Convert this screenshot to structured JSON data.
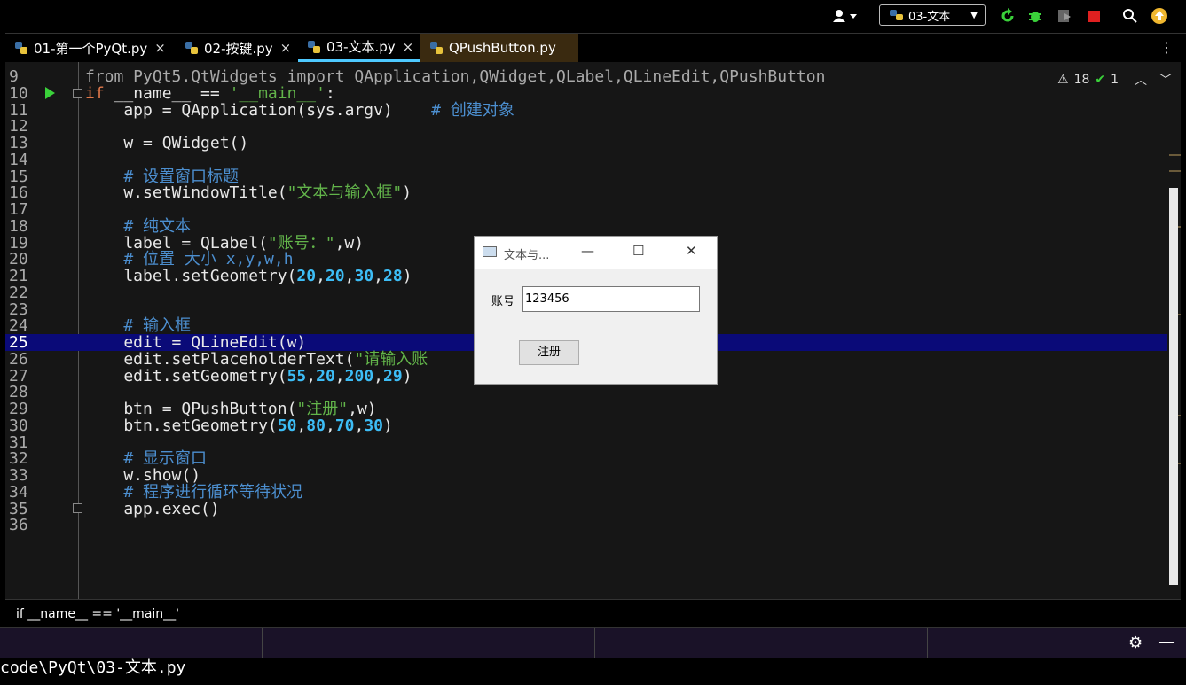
{
  "toolbar": {
    "run_config": "03-文本",
    "icons": [
      "user-icon",
      "run-icon",
      "debug-icon",
      "coverage-icon",
      "stop-icon",
      "search-icon",
      "update-icon"
    ]
  },
  "tabs": [
    {
      "label": "01-第一个PyQt.py"
    },
    {
      "label": "02-按键.py"
    },
    {
      "label": "03-文本.py"
    },
    {
      "label": "QPushButton.py"
    }
  ],
  "editor": {
    "top_fragment": "from PyQt5.QtWidgets import QApplication,QWidget,QLabel,QLineEdit,QPushButton",
    "inspections": {
      "warnings": "18",
      "ok": "1"
    },
    "lines": [
      {
        "n": "9",
        "segs": []
      },
      {
        "n": "10",
        "segs": [
          {
            "c": "kw",
            "t": "if "
          },
          {
            "c": "fn",
            "t": "__name__ == "
          },
          {
            "c": "str",
            "t": "'__main__'"
          },
          {
            "c": "fn",
            "t": ":"
          }
        ]
      },
      {
        "n": "11",
        "segs": [
          {
            "c": "fn",
            "t": "    app = QApplication(sys.argv)    "
          },
          {
            "c": "cmt",
            "t": "# 创建对象"
          }
        ]
      },
      {
        "n": "12",
        "segs": []
      },
      {
        "n": "13",
        "segs": [
          {
            "c": "fn",
            "t": "    w = QWidget()"
          }
        ]
      },
      {
        "n": "14",
        "segs": []
      },
      {
        "n": "15",
        "segs": [
          {
            "c": "cmt",
            "t": "    # 设置窗口标题"
          }
        ]
      },
      {
        "n": "16",
        "segs": [
          {
            "c": "fn",
            "t": "    w.setWindowTitle("
          },
          {
            "c": "str",
            "t": "\"文本与输入框\""
          },
          {
            "c": "fn",
            "t": ")"
          }
        ]
      },
      {
        "n": "17",
        "segs": []
      },
      {
        "n": "18",
        "segs": [
          {
            "c": "cmt",
            "t": "    # 纯文本"
          }
        ]
      },
      {
        "n": "19",
        "segs": [
          {
            "c": "fn",
            "t": "    label = QLabel("
          },
          {
            "c": "str",
            "t": "\"账号：\""
          },
          {
            "c": "fn",
            "t": ",w)"
          }
        ]
      },
      {
        "n": "20",
        "segs": [
          {
            "c": "cmt",
            "t": "    # 位置 大小 x,y,w,h"
          }
        ]
      },
      {
        "n": "21",
        "segs": [
          {
            "c": "fn",
            "t": "    label.setGeometry("
          },
          {
            "c": "num",
            "t": "20"
          },
          {
            "c": "fn",
            "t": ","
          },
          {
            "c": "num",
            "t": "20"
          },
          {
            "c": "fn",
            "t": ","
          },
          {
            "c": "num",
            "t": "30"
          },
          {
            "c": "fn",
            "t": ","
          },
          {
            "c": "num",
            "t": "28"
          },
          {
            "c": "fn",
            "t": ")"
          }
        ]
      },
      {
        "n": "22",
        "segs": []
      },
      {
        "n": "23",
        "segs": []
      },
      {
        "n": "24",
        "segs": [
          {
            "c": "cmt",
            "t": "    # 输入框"
          }
        ]
      },
      {
        "n": "25",
        "segs": [
          {
            "c": "fn",
            "t": "    edit = QLineEdit(w)"
          }
        ]
      },
      {
        "n": "26",
        "segs": [
          {
            "c": "fn",
            "t": "    edit.setPlaceholderText("
          },
          {
            "c": "str",
            "t": "\"请输入账"
          }
        ]
      },
      {
        "n": "27",
        "segs": [
          {
            "c": "fn",
            "t": "    edit.setGeometry("
          },
          {
            "c": "num",
            "t": "55"
          },
          {
            "c": "fn",
            "t": ","
          },
          {
            "c": "num",
            "t": "20"
          },
          {
            "c": "fn",
            "t": ","
          },
          {
            "c": "num",
            "t": "200"
          },
          {
            "c": "fn",
            "t": ","
          },
          {
            "c": "num",
            "t": "29"
          },
          {
            "c": "fn",
            "t": ")"
          }
        ]
      },
      {
        "n": "28",
        "segs": []
      },
      {
        "n": "29",
        "segs": [
          {
            "c": "fn",
            "t": "    btn = QPushButton("
          },
          {
            "c": "str",
            "t": "\"注册\""
          },
          {
            "c": "fn",
            "t": ",w)"
          }
        ]
      },
      {
        "n": "30",
        "segs": [
          {
            "c": "fn",
            "t": "    btn.setGeometry("
          },
          {
            "c": "num",
            "t": "50"
          },
          {
            "c": "fn",
            "t": ","
          },
          {
            "c": "num",
            "t": "80"
          },
          {
            "c": "fn",
            "t": ","
          },
          {
            "c": "num",
            "t": "70"
          },
          {
            "c": "fn",
            "t": ","
          },
          {
            "c": "num",
            "t": "30"
          },
          {
            "c": "fn",
            "t": ")"
          }
        ]
      },
      {
        "n": "31",
        "segs": []
      },
      {
        "n": "32",
        "segs": [
          {
            "c": "cmt",
            "t": "    # 显示窗口"
          }
        ]
      },
      {
        "n": "33",
        "segs": [
          {
            "c": "fn",
            "t": "    w.show()"
          }
        ]
      },
      {
        "n": "34",
        "segs": [
          {
            "c": "cmt",
            "t": "    # 程序进行循环等待状况"
          }
        ]
      },
      {
        "n": "35",
        "segs": [
          {
            "c": "fn",
            "t": "    app.exec()"
          }
        ]
      },
      {
        "n": "36",
        "segs": []
      }
    ],
    "current_line": "25"
  },
  "breadcrumb": "if __name__ == '__main__'",
  "terminal": "code\\PyQt\\03-文本.py",
  "qt_window": {
    "title": "文本与...",
    "label": "账号",
    "edit_value": "123456",
    "button": "注册"
  },
  "colors": {
    "accent_tab": "#4ec9ff",
    "current_line": "#0a0a78",
    "keyword": "#e0784a",
    "string": "#62b44a",
    "comment": "#4c8fd0",
    "number": "#3dbdf6"
  }
}
